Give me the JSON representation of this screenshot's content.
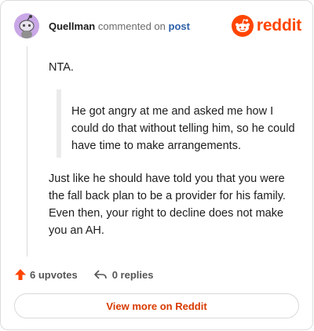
{
  "header": {
    "author": "Quellman",
    "verb": "commented on",
    "post_link": "post",
    "brand": "reddit"
  },
  "comment": {
    "paragraph1": "NTA.",
    "quote": "He got angry at me and asked me how I could do that without telling him, so he could have time to make arrangements.",
    "paragraph2": "Just like he should have told you that you were the fall back plan to be a provider for his family. Even then, your right to decline does not make you an AH."
  },
  "actions": {
    "upvotes": "6 upvotes",
    "replies": "0 replies"
  },
  "footer": {
    "view_more": "View more on Reddit"
  },
  "colors": {
    "accent": "#ff4500",
    "link": "#2c5fa8",
    "avatar": "#c9a7e6"
  },
  "icons": [
    "snoo-avatar-icon",
    "reddit-logo-icon",
    "upvote-arrow-icon",
    "reply-arrow-icon"
  ]
}
